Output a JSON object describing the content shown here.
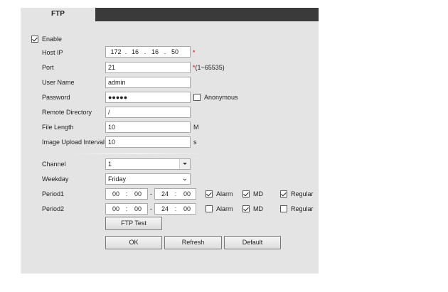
{
  "tab": {
    "label": "FTP"
  },
  "enable": {
    "label": "Enable",
    "checked": true
  },
  "host_ip": {
    "label": "Host IP",
    "octets": [
      "172",
      "16",
      "16",
      "50"
    ],
    "required_mark": "*"
  },
  "port": {
    "label": "Port",
    "value": "21",
    "hint": "*(1~65535)"
  },
  "user_name": {
    "label": "User Name",
    "value": "admin"
  },
  "password": {
    "label": "Password",
    "value": "●●●●●"
  },
  "anonymous": {
    "label": "Anonymous",
    "checked": false
  },
  "remote_directory": {
    "label": "Remote Directory",
    "value": "/"
  },
  "file_length": {
    "label": "File Length",
    "value": "10",
    "unit": "M"
  },
  "image_upload_interval": {
    "label": "Image Upload Interval",
    "value": "10",
    "unit": "s"
  },
  "channel": {
    "label": "Channel",
    "value": "1"
  },
  "weekday": {
    "label": "Weekday",
    "value": "Friday"
  },
  "time_sep": ":",
  "range_sep": "-",
  "periods": [
    {
      "label": "Period1",
      "start_h": "00",
      "start_m": "00",
      "end_h": "24",
      "end_m": "00",
      "alarm": true,
      "md": true,
      "regular": true
    },
    {
      "label": "Period2",
      "start_h": "00",
      "start_m": "00",
      "end_h": "24",
      "end_m": "00",
      "alarm": false,
      "md": true,
      "regular": false
    }
  ],
  "flags": {
    "alarm": "Alarm",
    "md": "MD",
    "regular": "Regular"
  },
  "buttons": {
    "ftp_test": "FTP Test",
    "ok": "OK",
    "refresh": "Refresh",
    "default": "Default"
  }
}
